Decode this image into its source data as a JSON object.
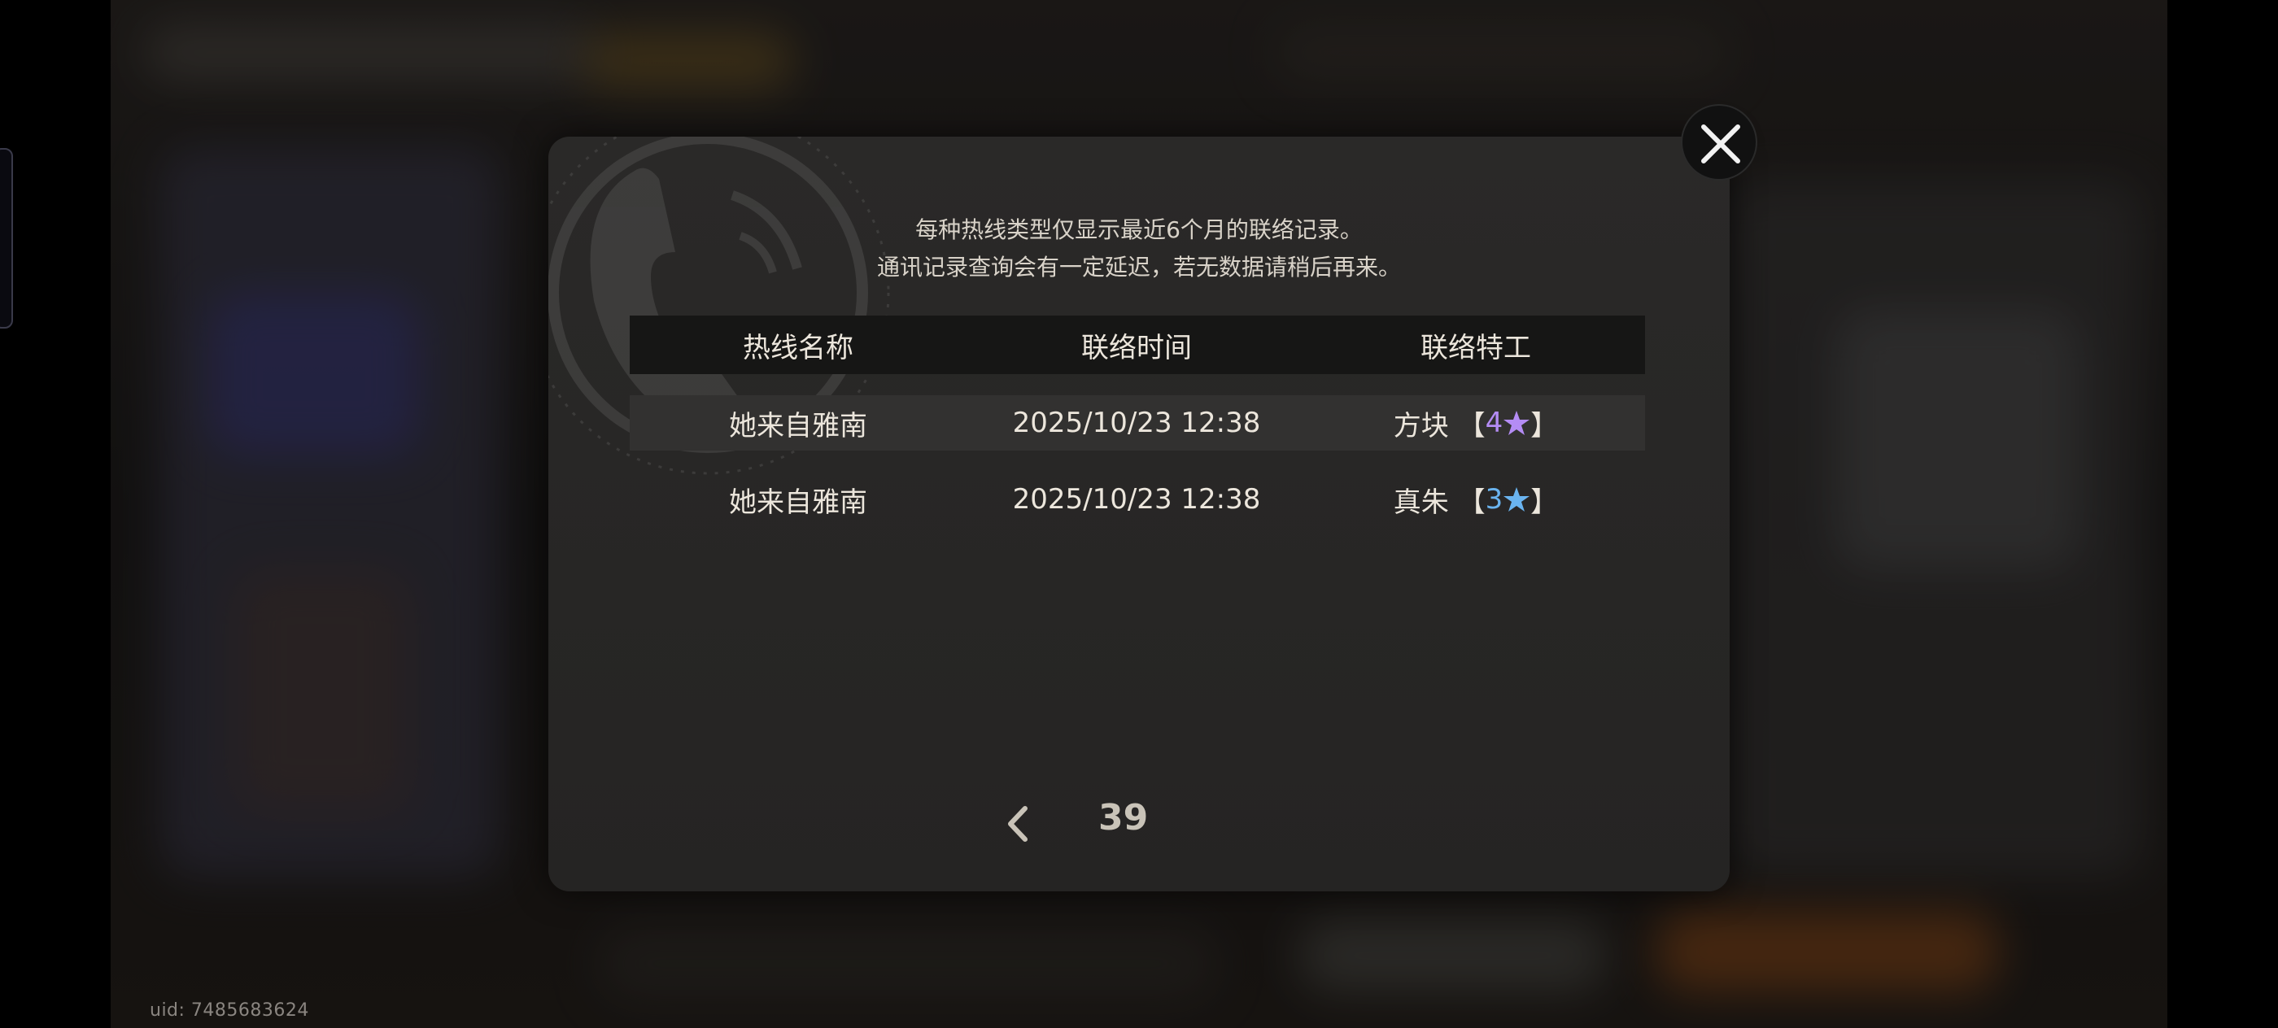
{
  "notice": {
    "line1": "每种热线类型仅显示最近6个月的联络记录。",
    "line2": "通讯记录查询会有一定延迟，若无数据请稍后再来。"
  },
  "table": {
    "columns": [
      "热线名称",
      "联络时间",
      "联络特工"
    ],
    "rows": [
      {
        "hotline": "她来自雅南",
        "time": "2025/10/23 12:38",
        "agent": "方块",
        "bracket_open": "【",
        "rank": "4",
        "bracket_close": "】",
        "rank_color": "#b48cf4",
        "rank_icon": "purple-star-icon"
      },
      {
        "hotline": "她来自雅南",
        "time": "2025/10/23 12:38",
        "agent": "真朱",
        "bracket_open": "【",
        "rank": "3",
        "bracket_close": "】",
        "rank_color": "#6ab4f0",
        "rank_icon": "blue-star-icon"
      }
    ]
  },
  "pager": {
    "page": "39",
    "prev_icon": "chevron-left-icon"
  },
  "close_icon": "close-icon",
  "uid": "uid: 7485683624"
}
